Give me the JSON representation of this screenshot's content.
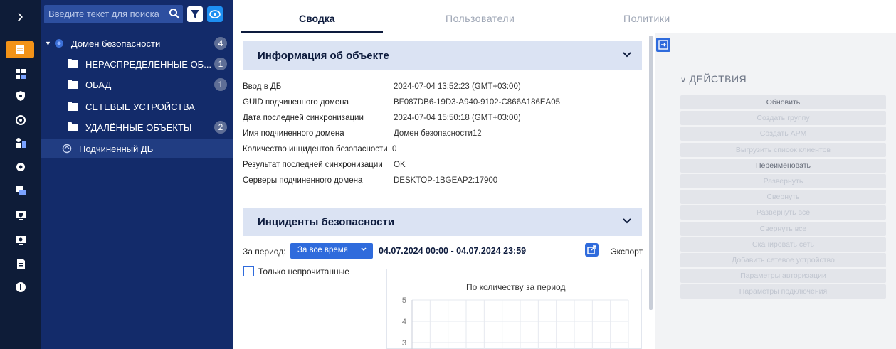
{
  "search": {
    "placeholder": "Введите текст для поиска"
  },
  "tree": {
    "root": {
      "label": "Домен безопасности",
      "count": "4"
    },
    "items": [
      {
        "label": "НЕРАСПРЕДЕЛЁННЫЕ ОБ...",
        "count": "1"
      },
      {
        "label": "ОБАД",
        "count": "1"
      },
      {
        "label": "СЕТЕВЫЕ УСТРОЙСТВА",
        "count": ""
      },
      {
        "label": "УДАЛЁННЫЕ ОБЪЕКТЫ",
        "count": "2"
      }
    ],
    "selected": {
      "label": "Подчиненный ДБ"
    }
  },
  "tabs": [
    "Сводка",
    "Пользователи",
    "Политики"
  ],
  "info_section": {
    "title": "Информация об объекте",
    "rows": [
      {
        "label": "Ввод в ДБ",
        "value": "2024-07-04 13:52:23 (GMT+03:00)"
      },
      {
        "label": "GUID подчиненного домена",
        "value": "BF087DB6-19D3-A940-9102-C866A186EA05"
      },
      {
        "label": "Дата последней синхронизации",
        "value": "2024-07-04 15:50:18 (GMT+03:00)"
      },
      {
        "label": "Имя подчиненного домена",
        "value": "Домен безопасности12"
      },
      {
        "label": "Количество инцидентов безопасности",
        "value": "0"
      },
      {
        "label": "Результат последней синхронизации",
        "value": "OK"
      },
      {
        "label": "Серверы подчиненного домена",
        "value": "DESKTOP-1BGEAP2:17900"
      }
    ]
  },
  "incidents_section": {
    "title": "Инциденты безопасности",
    "period_label": "За период:",
    "period_value": "За все время",
    "period_range": "04.07.2024 00:00 - 04.07.2024 23:59",
    "export_label": "Экспорт",
    "unread_only_label": "Только непрочитанные"
  },
  "chart_data": {
    "type": "line",
    "title": "По количеству за период",
    "xlabel": "",
    "ylabel": "",
    "y_ticks": [
      "5",
      "4",
      "3"
    ],
    "grid": true,
    "series": []
  },
  "actions": {
    "title": "ДЕЙСТВИЯ",
    "buttons": [
      {
        "label": "Обновить",
        "enabled": true
      },
      {
        "label": "Создать группу",
        "enabled": false
      },
      {
        "label": "Создать АРМ",
        "enabled": false
      },
      {
        "label": "Выгрузить список клиентов",
        "enabled": false
      },
      {
        "label": "Переименовать",
        "enabled": true
      },
      {
        "label": "Развернуть",
        "enabled": false
      },
      {
        "label": "Свернуть",
        "enabled": false
      },
      {
        "label": "Развернуть все",
        "enabled": false
      },
      {
        "label": "Свернуть все",
        "enabled": false
      },
      {
        "label": "Сканировать сеть",
        "enabled": false
      },
      {
        "label": "Добавить сетевое устройство",
        "enabled": false
      },
      {
        "label": "Параметры авторизации",
        "enabled": false
      },
      {
        "label": "Параметры подключения",
        "enabled": false
      }
    ]
  },
  "colors": {
    "rail_bg": "#0e1c38",
    "tree_bg": "#132b6a",
    "accent": "#2f6bdc",
    "active_orange": "#f39318"
  },
  "rail_icons": [
    "expand-icon",
    "summary-icon",
    "grid-icon",
    "shield-icon",
    "network-icon",
    "users-icon",
    "settings-icon",
    "devices-icon",
    "monitor-shield-icon",
    "monitor-icon",
    "document-icon",
    "info-icon"
  ]
}
